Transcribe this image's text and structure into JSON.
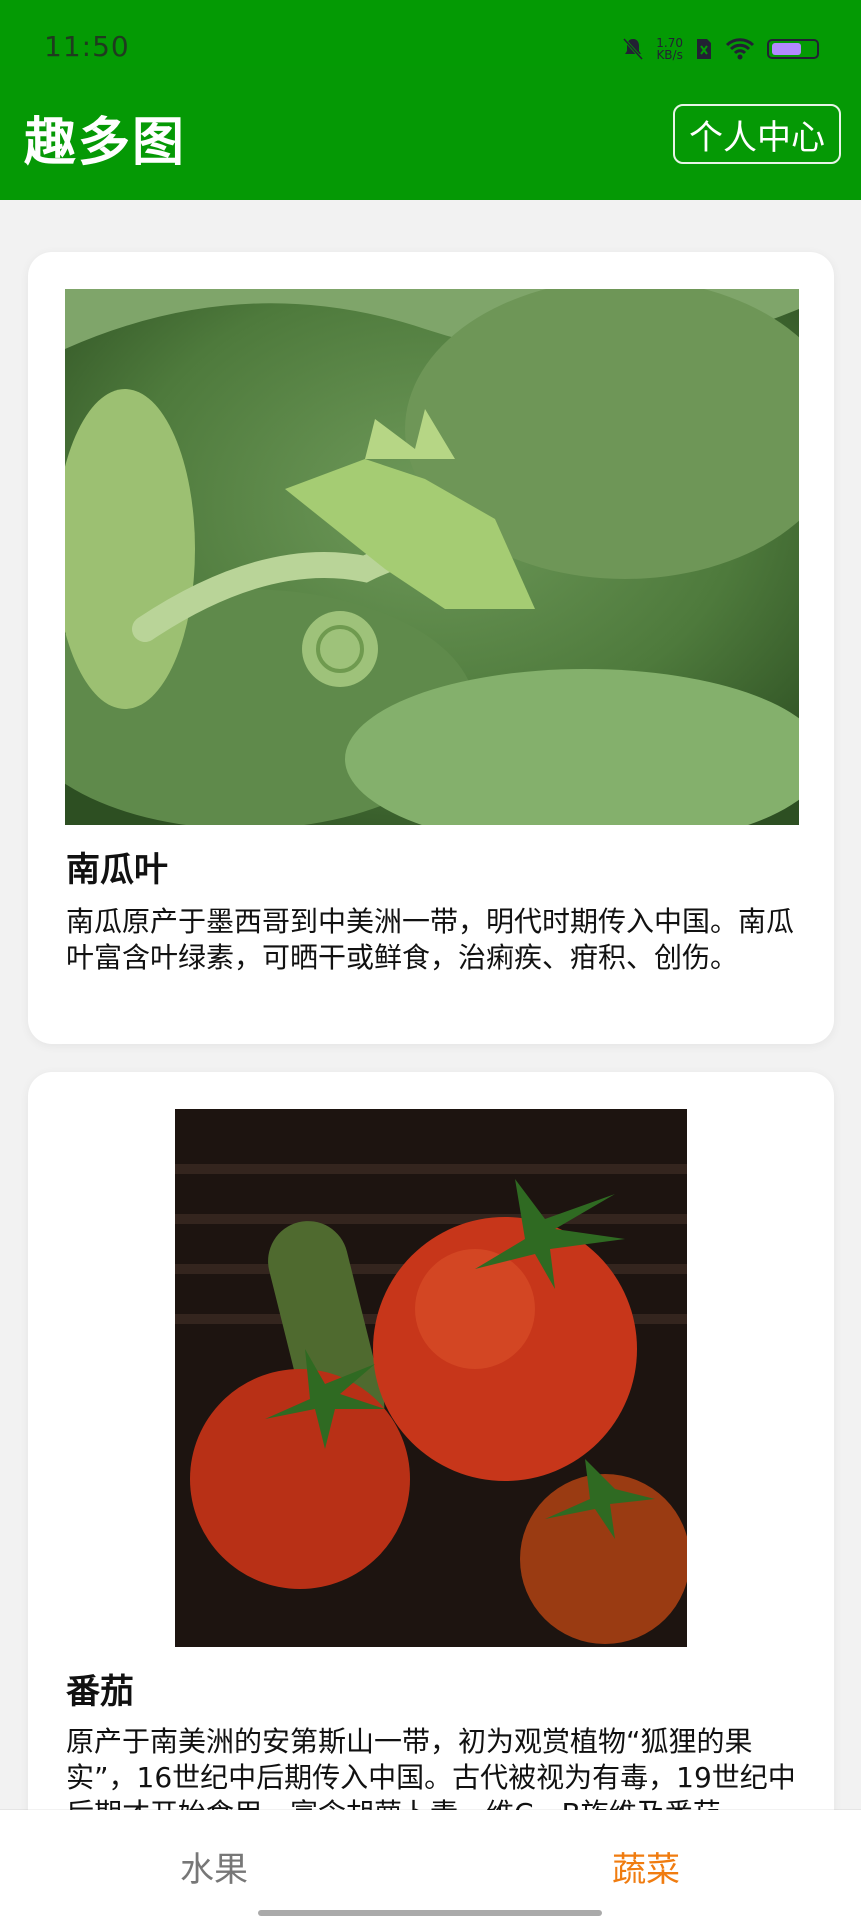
{
  "status_bar": {
    "time": "11:50",
    "net_speed": "1.70",
    "net_unit": "KB/s",
    "icons": [
      "bell-muted-icon",
      "sim-icon",
      "wifi-icon",
      "battery-icon"
    ],
    "battery_color": "#b389ff"
  },
  "header": {
    "title": "趣多图",
    "profile_button": "个人中心",
    "bg_color": "#059905"
  },
  "cards": [
    {
      "title": "南瓜叶",
      "description": "南瓜原产于墨西哥到中美洲一带，明代时期传入中国。南瓜叶富含叶绿素，可晒干或鲜食，治痢疾、疳积、创伤。"
    },
    {
      "title": "番茄",
      "description": "原产于南美洲的安第斯山一带，初为观赏植物“狐狸的果实”，16世纪中后期传入中国。古代被视为有毒，19世纪中后期才开始食用，富含胡萝卜素、维C、B族维及番茄"
    }
  ],
  "tabs": [
    {
      "label": "水果",
      "active": false
    },
    {
      "label": "蔬菜",
      "active": true
    }
  ],
  "colors": {
    "active_tab": "#f07c10",
    "inactive_tab": "#777777"
  }
}
